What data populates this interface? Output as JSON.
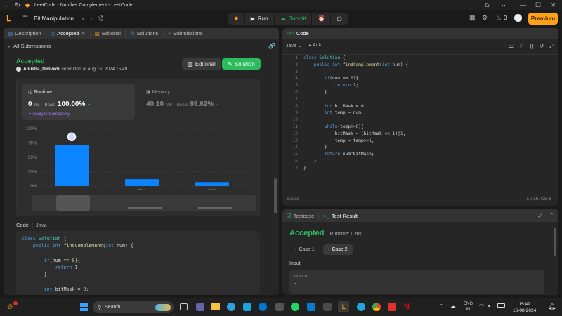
{
  "window": {
    "title": "LeetCode - Number Complement - LeetCode"
  },
  "topbar": {
    "problem_title": "Bit Manipulation",
    "run_label": "Run",
    "submit_label": "Submit",
    "streak_count": "0",
    "premium_label": "Premium"
  },
  "left_tabs": [
    {
      "label": "Description"
    },
    {
      "label": "Accepted"
    },
    {
      "label": "Editorial"
    },
    {
      "label": "Solutions"
    },
    {
      "label": "Submissions"
    }
  ],
  "submission": {
    "back_label": "All Submissions",
    "status": "Accepted",
    "user": "Amisha_Dwivedi",
    "submitted_text": "submitted at Aug 16, 2024 15:49",
    "editorial_btn": "Editorial",
    "solution_btn": "Solution",
    "runtime_title": "Runtime",
    "runtime_value": "0",
    "runtime_unit": "ms",
    "beats_label": "Beats",
    "runtime_beats": "100.00%",
    "analyze_label": "Analyze Complexity",
    "memory_title": "Memory",
    "memory_value": "40.10",
    "memory_unit": "MB",
    "memory_beats": "89.62%"
  },
  "chart_data": {
    "type": "bar",
    "categories": [
      "0ms",
      "1ms",
      "2ms"
    ],
    "values": [
      71,
      12,
      7
    ],
    "ylim": [
      0,
      100
    ],
    "yticks": [
      "100%",
      "75%",
      "50%",
      "25%",
      "0%"
    ],
    "xtick_labels": [
      "",
      "1ms",
      "2ms"
    ],
    "highlight_index": 0,
    "bar_color": "#0a84ff"
  },
  "code_section": {
    "code_label": "Code",
    "lang_label": "Java"
  },
  "left_code_lines": [
    "class Solution {",
    "    public int findComplement(int num) {",
    "",
    "        if(num == 0){",
    "            return 1;",
    "        }",
    "",
    "        int bitMask = 0;"
  ],
  "editor": {
    "title": "Code",
    "lang": "Java",
    "mode": "Auto",
    "saved": "Saved",
    "cursor": "Ln 16, Col 6",
    "lines": [
      "class Solution {",
      "    public int findComplement(int num) {",
      "",
      "        if(num == 0){",
      "            return 1;",
      "        }",
      "",
      "        int bitMask = 0;",
      "        int temp = num;",
      "",
      "        while(temp!=0){",
      "            bitMask = (bitMask << 1)|1;",
      "            temp = temp>>1;",
      "        }",
      "        return num^bitMask;",
      "    }",
      "}"
    ]
  },
  "result": {
    "testcase_tab": "Testcase",
    "result_tab": "Test Result",
    "status": "Accepted",
    "runtime": "Runtime: 0 ms",
    "cases": [
      "Case 1",
      "Case 2"
    ],
    "input_label": "Input",
    "var_label": "num =",
    "var_value": "1"
  },
  "taskbar": {
    "search": "Search",
    "lang_top": "ENG",
    "lang_bottom": "IN",
    "time": "15:49",
    "date": "16-08-2024"
  }
}
